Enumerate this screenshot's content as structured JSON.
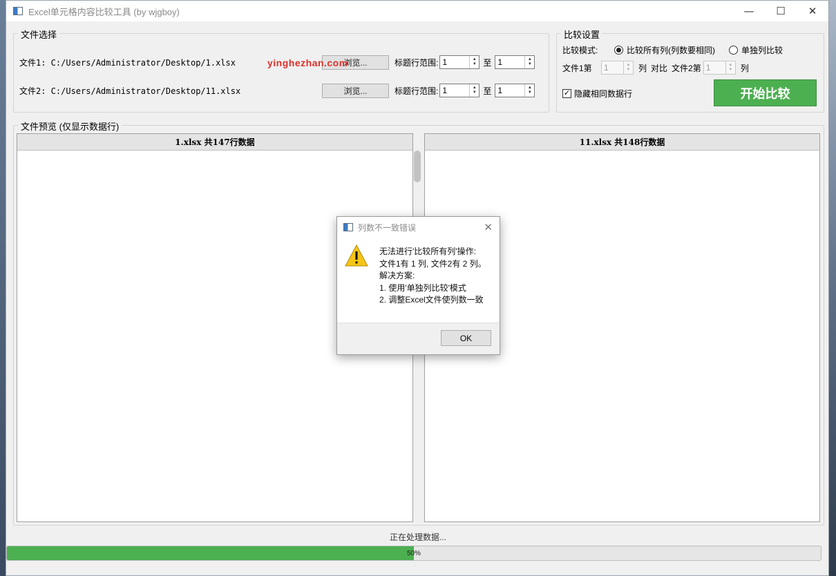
{
  "window": {
    "title": "Excel单元格内容比较工具 (by wjgboy)",
    "controls": {
      "minimize": "—",
      "maximize": "☐",
      "close": "✕"
    }
  },
  "file_select": {
    "group_title": "文件选择",
    "file1": {
      "label": "文件1: C:/Users/Administrator/Desktop/1.xlsx",
      "browse": "浏览...",
      "header_range_label": "标题行范围:",
      "from": "1",
      "to_label": "至",
      "to": "1"
    },
    "file2": {
      "label": "文件2: C:/Users/Administrator/Desktop/11.xlsx",
      "browse": "浏览...",
      "header_range_label": "标题行范围:",
      "from": "1",
      "to_label": "至",
      "to": "1"
    }
  },
  "compare_settings": {
    "group_title": "比较设置",
    "mode_label": "比较模式:",
    "mode_all": "比较所有列(列数要相同)",
    "mode_single": "单独列比较",
    "selected_mode": "all",
    "file1_col_label": "文件1第",
    "file1_col": "1",
    "col_unit1": "列",
    "versus": "对比",
    "file2_col_label": "文件2第",
    "file2_col": "1",
    "col_unit2": "列",
    "hide_same_label": "隐藏相同数据行",
    "hide_same_checked": true,
    "start_button": "开始比较"
  },
  "preview": {
    "group_title": "文件预览 (仅显示数据行)",
    "left_header": "1.xlsx 共147行数据",
    "right_header": "11.xlsx 共148行数据"
  },
  "status": {
    "text": "正在处理数据...",
    "progress": 0.5,
    "progress_label": "50%"
  },
  "watermark": "yinghezhan.com",
  "dialog": {
    "title": "列数不一致错误",
    "message": "无法进行'比较所有列'操作:\n文件1有 1 列, 文件2有 2 列。\n解决方案:\n1. 使用'单独列比较'模式\n2. 调整Excel文件使列数一致",
    "ok": "OK"
  },
  "colors": {
    "accent_green": "#4caf50",
    "warning_yellow": "#f5c518",
    "watermark_red": "#e0302b"
  },
  "icons": {
    "app": "app-window-icon",
    "warning": "warning-triangle-icon",
    "check": "checkmark-icon"
  }
}
